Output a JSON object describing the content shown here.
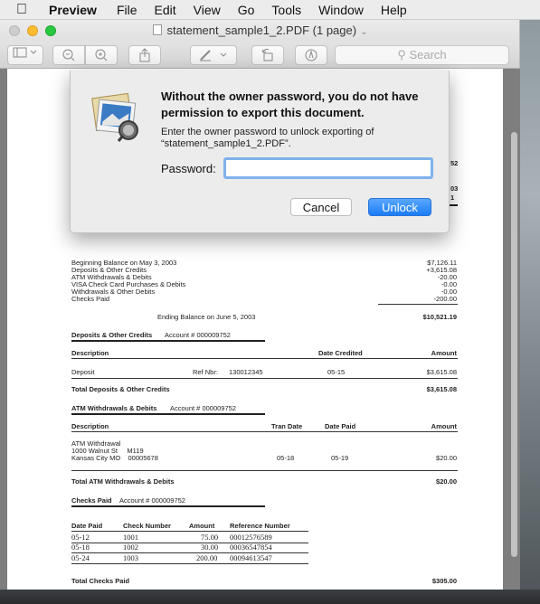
{
  "menubar": {
    "app": "Preview",
    "items": [
      "File",
      "Edit",
      "View",
      "Go",
      "Tools",
      "Window",
      "Help"
    ]
  },
  "window": {
    "title": "statement_sample1_2.PDF (1 page)"
  },
  "toolbar": {
    "search_placeholder": "Search"
  },
  "dialog": {
    "title": "Without the owner password, you do not have permission to export this document.",
    "message": "Enter the owner password to unlock exporting of “statement_sample1_2.PDF”.",
    "password_label": "Password:",
    "password_value": "",
    "cancel_label": "Cancel",
    "unlock_label": "Unlock"
  },
  "document": {
    "partial_right": [
      "52",
      "03",
      "1"
    ],
    "summary": {
      "lines": [
        "Beginning Balance on May 3, 2003",
        "Deposits & Other Credits",
        "ATM Withdrawals & Debits",
        "VISA Check Card Purchases & Debits",
        "Withdrawals & Other Debits",
        "Checks Paid"
      ],
      "amounts": [
        "$7,126.11",
        "+3,615.08",
        "-20.00",
        "-0.00",
        "-0.00",
        "-200.00"
      ],
      "ending_label": "Ending Balance on June 5, 2003",
      "ending_amount": "$10,521.19"
    },
    "deposits": {
      "heading": "Deposits & Other Credits",
      "account": "Account # 000009752",
      "col_description": "Description",
      "col_date": "Date Credited",
      "col_amount": "Amount",
      "row_desc": "Deposit",
      "row_ref_label": "Ref Nbr:",
      "row_ref": "130012345",
      "row_date": "05-15",
      "row_amount": "$3,615.08",
      "total_label": "Total Deposits & Other Credits",
      "total_amount": "$3,615.08"
    },
    "atm": {
      "heading": "ATM Withdrawals & Debits",
      "account": "Account # 000009752",
      "col_description": "Description",
      "col_tran": "Tran Date",
      "col_paid": "Date Paid",
      "col_amount": "Amount",
      "row_line1": "ATM Withdrawal",
      "row_line2": "1000 Walnut St     M119",
      "row_line3": "Kansas City MO    00005678",
      "row_tran": "05-18",
      "row_paid": "05-19",
      "row_amount": "$20.00",
      "total_label": "Total ATM Withdrawals & Debits",
      "total_amount": "$20.00"
    },
    "checks": {
      "heading": "Checks Paid",
      "account": "Account # 000009752",
      "col_date": "Date Paid",
      "col_number": "Check Number",
      "col_amount": "Amount",
      "col_ref": "Reference Number",
      "rows": [
        {
          "date": "05-12",
          "number": "1001",
          "amount": "75.00",
          "ref": "00012576589"
        },
        {
          "date": "05-18",
          "number": "1002",
          "amount": "30.00",
          "ref": "00036547854"
        },
        {
          "date": "05-24",
          "number": "1003",
          "amount": "200.00",
          "ref": "00094613547"
        }
      ],
      "total_label": "Total Checks Paid",
      "total_amount": "$305.00"
    }
  }
}
